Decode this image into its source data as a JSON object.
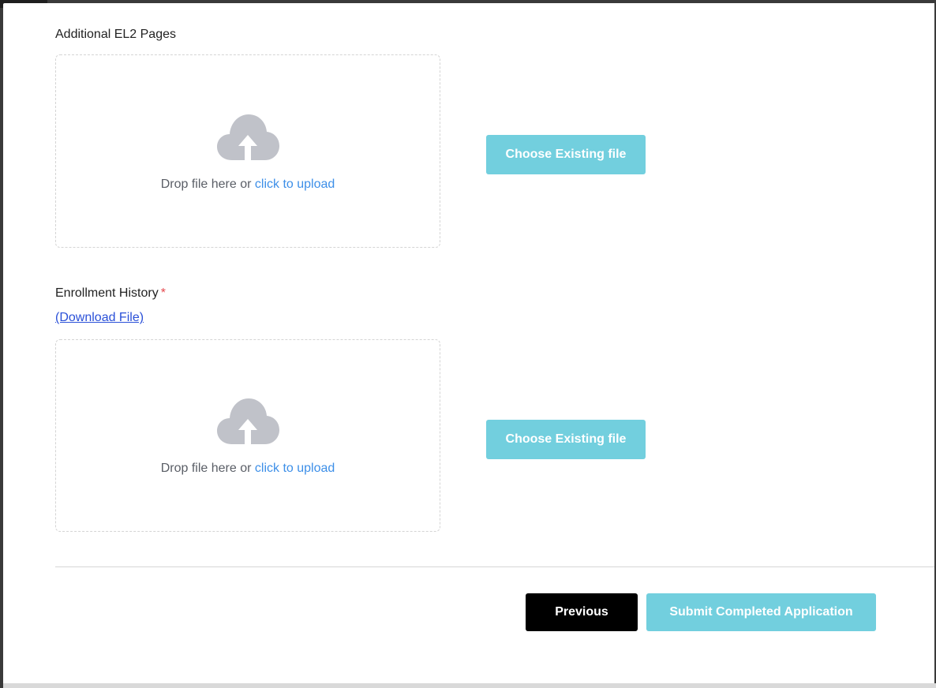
{
  "sections": [
    {
      "label": "Additional EL2 Pages",
      "dropzone": {
        "icon": "cloud-upload-icon",
        "text": "Drop file here or ",
        "link_text": "click to upload"
      },
      "choose_button": "Choose Existing file"
    },
    {
      "label": "Enrollment History",
      "required_marker": "*",
      "download_link": "(Download File)",
      "dropzone": {
        "icon": "cloud-upload-icon",
        "text": "Drop file here or ",
        "link_text": "click to upload"
      },
      "choose_button": "Choose Existing file"
    }
  ],
  "footer": {
    "previous_label": "Previous",
    "submit_label": "Submit Completed Application"
  },
  "colors": {
    "accent": "#72cfde",
    "link": "#3d8fe8",
    "required": "#e5484d",
    "icon": "#c0c2c9"
  }
}
